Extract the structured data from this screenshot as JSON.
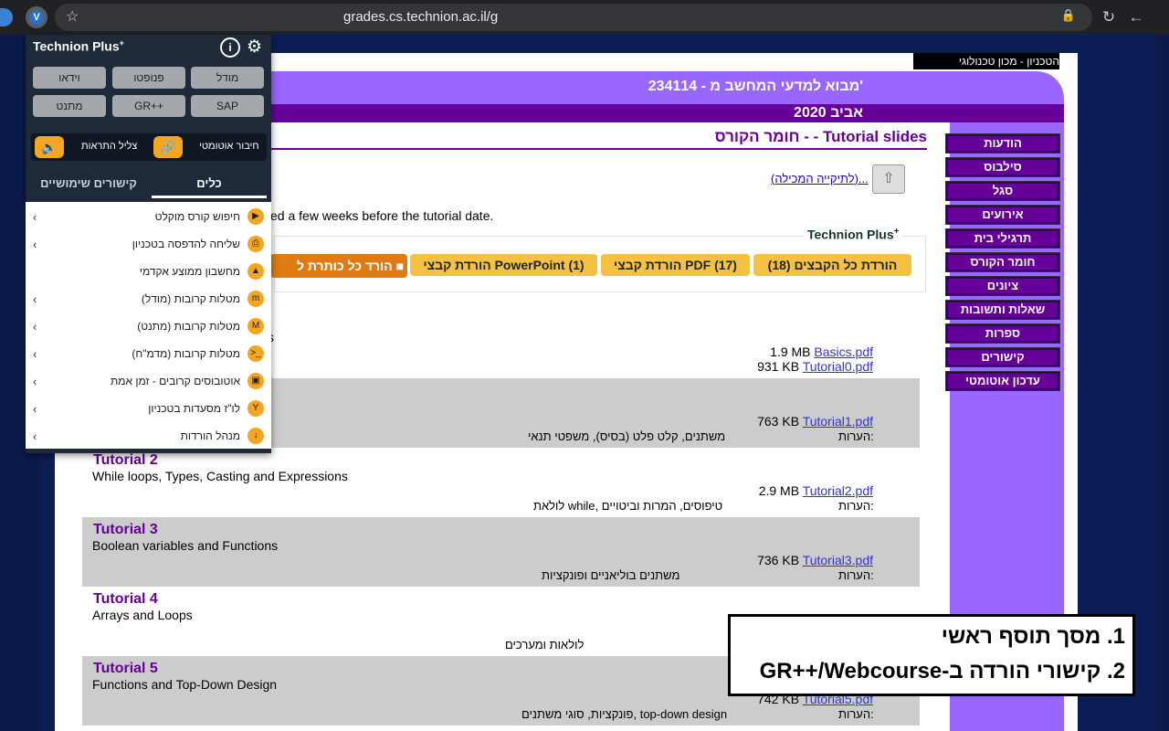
{
  "browser": {
    "url": "grades.cs.technion.ac.il/g",
    "lock_icon": "lock-icon",
    "nav_back": "←",
    "nav_reload": "↻",
    "star": "☆"
  },
  "site": {
    "top_link": "הטכניון - מכון טכנולוגי לישראל",
    "course_title": "234114 - מבוא למדעי המחשב מ'",
    "semester": "אביב 2020",
    "nav_items": [
      "הודעות",
      "סילבוס",
      "סגל",
      "אירועים",
      "תרגילי בית",
      "חומר הקורס",
      "ציונים",
      "שאלות ותשובות",
      "ספרות",
      "קישורים",
      "עדכון אוטומטי"
    ],
    "section_title": "חומר הקורס - - Tutorial slides",
    "up_link": "(לתיקייה המכילה)...",
    "intro_text": "ed a few weeks before the tutorial date.",
    "tp_label": "Technion Plus",
    "buttons": {
      "all": "הורדת כל הקבצים (18)",
      "pdf": "הורדת קבצי PDF (17)",
      "ppt": "הורדת קבצי PowerPoint (1)",
      "all_titles": "הורד כל כותרת ל"
    },
    "notes_label": "הערות:",
    "tut0": {
      "sub": "s",
      "file1_size": "1.9 MB",
      "file1": "Basics.pdf",
      "file2_size": "931 KB",
      "file2": "Tutorial0.pdf"
    },
    "tut1": {
      "file_size": "763 KB",
      "file": "Tutorial1.pdf",
      "note": "משתנים, קלט פלט (בסיס), משפטי תנאי"
    },
    "tut2": {
      "title": "Tutorial 2",
      "sub": "While loops, Types, Casting and Expressions",
      "file_size": "2.9 MB",
      "file": "Tutorial2.pdf",
      "note": "לולאת while, טיפוסים, המרות וביטויים"
    },
    "tut3": {
      "title": "Tutorial 3",
      "sub": "Boolean variables and Functions",
      "file_size": "736 KB",
      "file": "Tutorial3.pdf",
      "note": "משתנים בוליאניים ופונקציות"
    },
    "tut4": {
      "title": "Tutorial 4",
      "sub": "Arrays and Loops",
      "note": "לולאות ומערכים"
    },
    "tut5": {
      "title": "Tutorial 5",
      "sub": "Functions and Top-Down Design",
      "file_size": "742 KB",
      "file": "Tutorial5.pdf",
      "note": "פונקציות, סוגי משתנים, top-down design"
    }
  },
  "popup": {
    "title": "Technion Plus",
    "buttons_row1": [
      "וידאו",
      "פנופטו",
      "מודל"
    ],
    "buttons_row2": [
      "מתנט",
      "GR++",
      "SAP"
    ],
    "auto_connect": "חיבור אוטומטי",
    "mute_alerts": "צליל התראות",
    "tab_tools": "כלים",
    "tab_links": "קישורים שימושיים",
    "list": [
      {
        "label": "חיפוש קורס מוקלט",
        "icon": "video-icon",
        "chevron": true
      },
      {
        "label": "שליחה להדפסה בטכניון",
        "icon": "printer-icon",
        "chevron": true
      },
      {
        "label": "מחשבון ממוצע אקדמי",
        "icon": "graduation-cap-icon",
        "chevron": false
      },
      {
        "label": "מטלות קרובות (מודל)",
        "icon": "moodle-icon",
        "chevron": true
      },
      {
        "label": "מטלות קרובות (מתנט)",
        "icon": "matnet-icon",
        "chevron": true
      },
      {
        "label": "מטלות קרובות (מדמ\"ח)",
        "icon": "terminal-icon",
        "chevron": true
      },
      {
        "label": "אוטובוסים קרובים - זמן אמת",
        "icon": "bus-icon",
        "chevron": true
      },
      {
        "label": "לו\"ז מסעדות בטכניון",
        "icon": "restaurant-icon",
        "chevron": true
      },
      {
        "label": "מנהל הורדות",
        "icon": "download-icon",
        "chevron": true
      }
    ]
  },
  "annotation": {
    "line1": "1. מסך תוסף ראשי",
    "line2": "2. קישורי הורדה ב-GR++/Webcourse"
  }
}
